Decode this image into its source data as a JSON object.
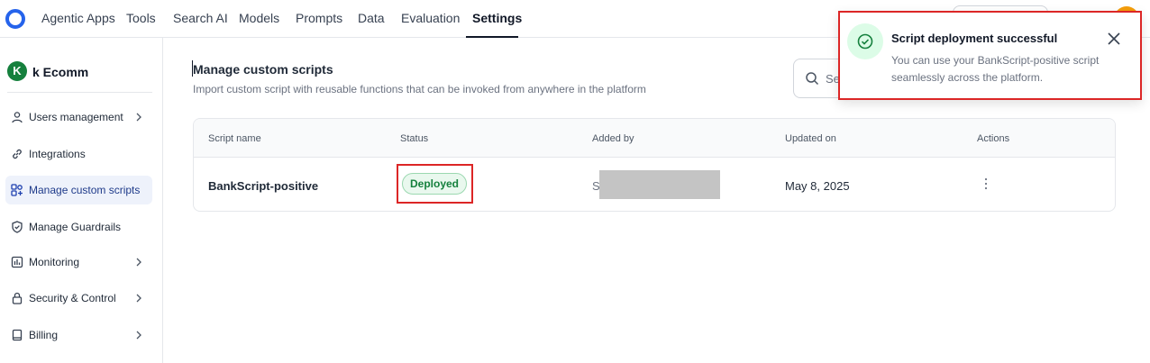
{
  "nav": {
    "items": [
      {
        "label": "Agentic Apps",
        "active": false
      },
      {
        "label": "Tools",
        "active": false
      },
      {
        "label": "Search AI",
        "active": false
      },
      {
        "label": "Models",
        "active": false
      },
      {
        "label": "Prompts",
        "active": false
      },
      {
        "label": "Data",
        "active": false
      },
      {
        "label": "Evaluation",
        "active": false
      },
      {
        "label": "Settings",
        "active": true
      }
    ]
  },
  "workspace": {
    "initial": "K",
    "name": "k Ecomm"
  },
  "sidebar": {
    "items": [
      {
        "label": "Users management",
        "icon": "user-icon",
        "has_submenu": true,
        "active": false
      },
      {
        "label": "Integrations",
        "icon": "link-icon",
        "has_submenu": false,
        "active": false
      },
      {
        "label": "Manage custom scripts",
        "icon": "scripts-icon",
        "has_submenu": false,
        "active": true
      },
      {
        "label": "Manage Guardrails",
        "icon": "shield-icon",
        "has_submenu": false,
        "active": false
      },
      {
        "label": "Monitoring",
        "icon": "chart-icon",
        "has_submenu": true,
        "active": false
      },
      {
        "label": "Security & Control",
        "icon": "lock-icon",
        "has_submenu": true,
        "active": false
      },
      {
        "label": "Billing",
        "icon": "book-icon",
        "has_submenu": true,
        "active": false
      }
    ]
  },
  "main": {
    "title": "Manage custom scripts",
    "subtitle": "Import custom script with reusable functions that can be invoked from anywhere in the platform",
    "search": {
      "placeholder": "Se"
    }
  },
  "table": {
    "columns": [
      "Script name",
      "Status",
      "Added by",
      "Updated on",
      "Actions"
    ],
    "rows": [
      {
        "script_name": "BankScript-positive",
        "status": "Deployed",
        "added_by_initial": "S",
        "updated_on": "May 8, 2025"
      }
    ]
  },
  "toast": {
    "title": "Script deployment successful",
    "message": "You can use your BankScript-positive script seamlessly across the platform."
  },
  "colors": {
    "accent": "#2563eb",
    "success": "#15803d",
    "highlight": "#dc2626"
  }
}
